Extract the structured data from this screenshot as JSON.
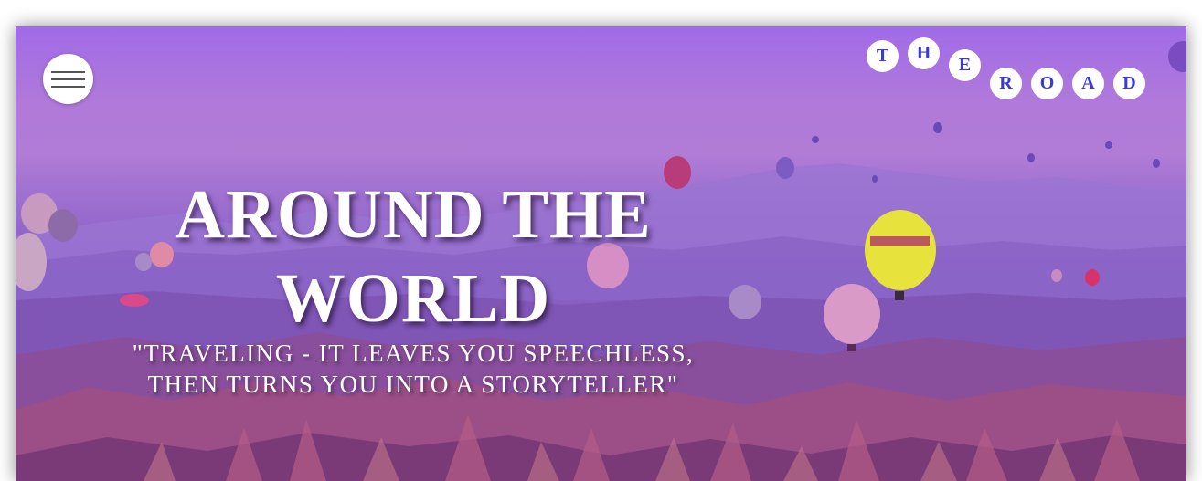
{
  "header": {
    "menu_icon": "hamburger-menu-icon",
    "logo_letters": [
      "T",
      "H",
      "E",
      "R",
      "O",
      "A",
      "D"
    ]
  },
  "hero": {
    "title_line1": "AROUND THE",
    "title_line2": "WORLD",
    "quote_line1": "\"TRAVELING - IT LEAVES YOU SPEECHLESS,",
    "quote_line2": "THEN TURNS YOU INTO A STORYTELLER\""
  },
  "colors": {
    "accent_text": "#3b3ad6",
    "overlay": "#a06be8",
    "title": "#ffffff"
  }
}
